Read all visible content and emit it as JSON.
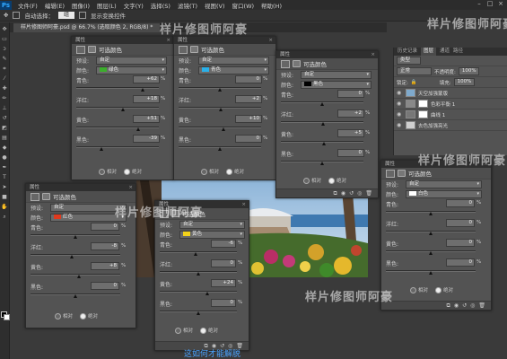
{
  "menubar": {
    "logo": "Ps",
    "items": [
      "文件(F)",
      "编辑(E)",
      "图像(I)",
      "图层(L)",
      "文字(Y)",
      "选择(S)",
      "滤镜(T)",
      "视图(V)",
      "窗口(W)",
      "帮助(H)"
    ],
    "window_controls": [
      "–",
      "□",
      "×"
    ]
  },
  "options_bar": {
    "auto_select_label": "自动选择：",
    "auto_select_value": "组",
    "transform_label": "显示变换控件"
  },
  "document_tab": "样片修图师阿豪.psd @ 66.7% (选取颜色 2, RGB/8) *",
  "panel_title": "属性",
  "panel_header": "可选颜色",
  "preset_label": "预设:",
  "preset_value": "自定",
  "colors_label": "颜色:",
  "relative_label": "相对",
  "absolute_label": "绝对",
  "percent": "%",
  "channel_labels": {
    "cyan": "青色:",
    "magenta": "洋红:",
    "yellow": "黄色:",
    "black": "黑色:"
  },
  "panels": [
    {
      "color_name": "绿色",
      "swatch": "#3cae2c",
      "cyan": "+62",
      "magenta": "+18",
      "yellow": "+51",
      "black": "-39"
    },
    {
      "color_name": "青色",
      "swatch": "#2ab0e8",
      "cyan": "0",
      "magenta": "+2",
      "yellow": "+10",
      "black": "0"
    },
    {
      "color_name": "黑色",
      "swatch": "#000000",
      "cyan": "0",
      "magenta": "+2",
      "yellow": "+5",
      "black": "0"
    },
    {
      "color_name": "红色",
      "swatch": "#e03a1e",
      "cyan": "0",
      "magenta": "-8",
      "yellow": "+8",
      "black": "0"
    },
    {
      "color_name": "黄色",
      "swatch": "#f2d21a",
      "cyan": "-6",
      "magenta": "0",
      "yellow": "+24",
      "black": "0"
    },
    {
      "color_name": "白色",
      "swatch": "#ffffff",
      "cyan": "0",
      "magenta": "0",
      "yellow": "0",
      "black": "0"
    }
  ],
  "layers_panel": {
    "tabs": [
      "历史记录",
      "图层",
      "通道",
      "路径"
    ],
    "kind_label": "类型",
    "blend_mode": "正常",
    "opacity_label": "不透明度:",
    "opacity": "100%",
    "fill_label": "填充:",
    "fill": "100%",
    "lock_label": "锁定:",
    "layers": [
      "天空加强蒙版",
      "色彩平衡 1",
      "曲线 1",
      "去色加强亮光"
    ]
  },
  "watermark": "样片修图师阿豪",
  "caption": "这如何才能解脱"
}
